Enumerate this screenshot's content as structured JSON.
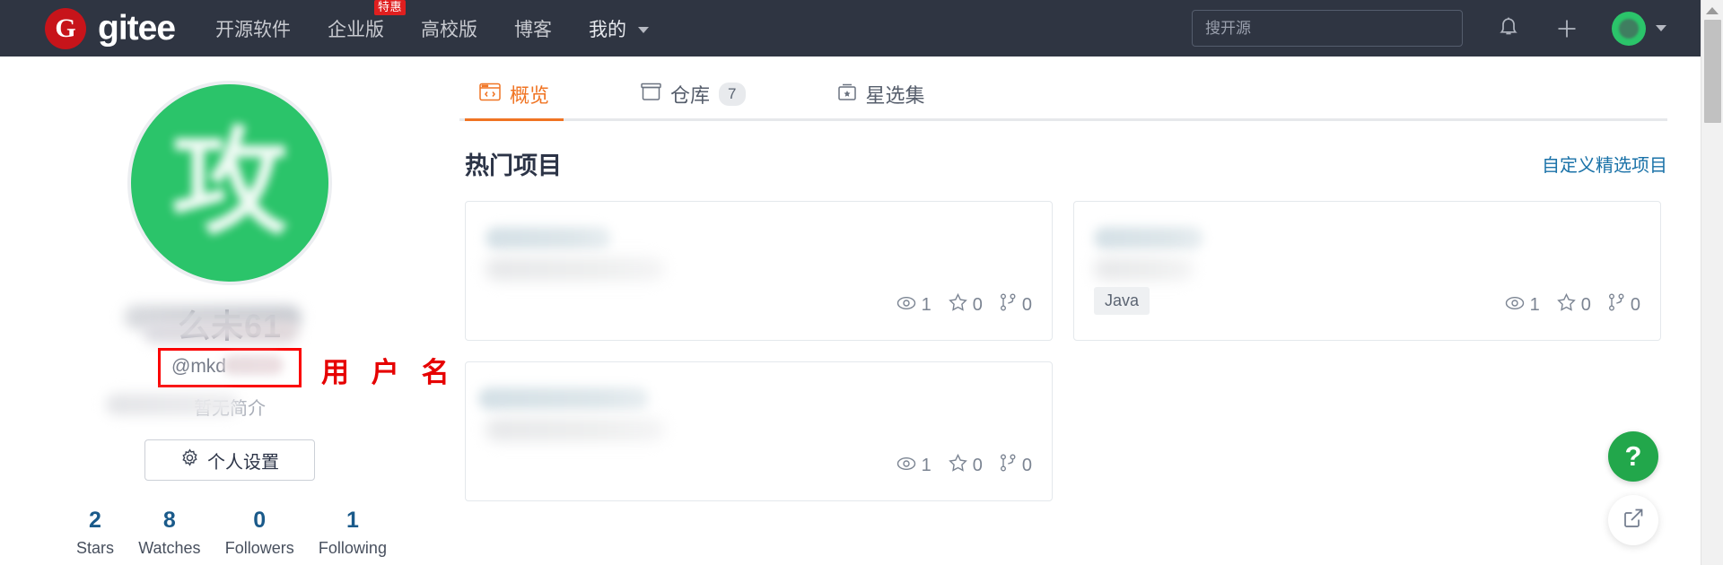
{
  "topnav": {
    "brand_mark": "G",
    "brand_text": "gitee",
    "links": [
      {
        "label": "开源软件",
        "badge": null
      },
      {
        "label": "企业版",
        "badge": "特惠"
      },
      {
        "label": "高校版",
        "badge": null
      },
      {
        "label": "博客",
        "badge": null
      },
      {
        "label": "我的",
        "badge": null,
        "has_caret": true
      }
    ],
    "search_placeholder": "搜开源",
    "search_value": "",
    "icons": [
      "bell-icon",
      "plus-icon",
      "user-avatar"
    ]
  },
  "profile": {
    "avatar_glyph": "攻",
    "display_name": "么未61",
    "username": "@mkd",
    "bio": "暂无简介",
    "settings_button": "个人设置",
    "annotation": "用 户 名",
    "stats": [
      {
        "value": "2",
        "label": "Stars"
      },
      {
        "value": "8",
        "label": "Watches"
      },
      {
        "value": "0",
        "label": "Followers"
      },
      {
        "value": "1",
        "label": "Following"
      }
    ]
  },
  "main": {
    "tabs": [
      {
        "label": "概览",
        "icon": "code-window-icon",
        "count": null,
        "active": true
      },
      {
        "label": "仓库",
        "icon": "repository-icon",
        "count": "7",
        "active": false
      },
      {
        "label": "星选集",
        "icon": "star-box-icon",
        "count": null,
        "active": false
      }
    ],
    "section_title": "热门项目",
    "section_link": "自定义精选项目",
    "cards": [
      {
        "title_blur_width": 140,
        "desc_blur_width": 200,
        "language": null,
        "watches": "1",
        "stars": "0",
        "forks": "0"
      },
      {
        "title_blur_width": 122,
        "desc_blur_width": 112,
        "language": "Java",
        "watches": "1",
        "stars": "0",
        "forks": "0"
      },
      {
        "title_blur_width": 190,
        "desc_blur_width": 200,
        "language": null,
        "watches": "1",
        "stars": "0",
        "forks": "0"
      }
    ]
  },
  "floating": {
    "help_label": "?",
    "share_label": "share-icon"
  },
  "colors": {
    "nav_bg": "#2f3542",
    "brand_red": "#c7141a",
    "accent_orange": "#f07423",
    "avatar_green": "#2bc46a",
    "link_blue": "#1a72a8",
    "annotation_red": "#e60000",
    "help_green": "#22a74b"
  }
}
